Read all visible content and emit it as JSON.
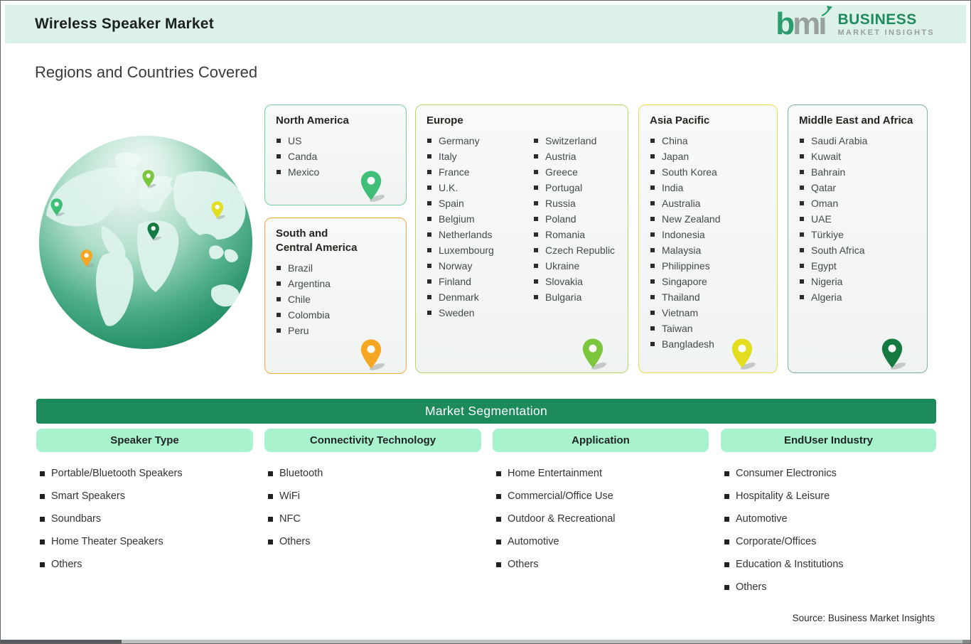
{
  "header": {
    "title": "Wireless Speaker Market",
    "logo": {
      "mark_b": "b",
      "mark_m": "m",
      "mark_i": "ı",
      "line1": "BUSINESS",
      "line2": "MARKET INSIGHTS"
    }
  },
  "section_title": "Regions and Countries Covered",
  "regions": [
    {
      "title_line1": "North America",
      "title_line2": "",
      "countries": [
        "US",
        "Canda",
        "Mexico"
      ]
    },
    {
      "title_line1": "South and",
      "title_line2": "Central America",
      "countries": [
        "Brazil",
        "Argentina",
        "Chile",
        "Colombia",
        "Peru"
      ]
    },
    {
      "title_line1": "Europe",
      "title_line2": "",
      "countries_col1": [
        "Germany",
        "Italy",
        "France",
        "U.K.",
        "Spain",
        "Belgium",
        "Netherlands",
        "Luxembourg",
        "Norway",
        "Finland",
        "Denmark",
        "Sweden"
      ],
      "countries_col2": [
        "Switzerland",
        "Austria",
        "Greece",
        "Portugal",
        "Russia",
        "Poland",
        "Romania",
        "Czech Republic",
        "Ukraine",
        "Slovakia",
        "Bulgaria"
      ]
    },
    {
      "title_line1": "Asia Pacific",
      "title_line2": "",
      "countries": [
        "China",
        "Japan",
        "South Korea",
        "India",
        "Australia",
        "New Zealand",
        "Indonesia",
        "Malaysia",
        "Philippines",
        "Singapore",
        "Thailand",
        "Vietnam",
        "Taiwan",
        "Bangladesh"
      ]
    },
    {
      "title_line1": "Middle East and Africa",
      "title_line2": "",
      "countries": [
        "Saudi Arabia",
        "Kuwait",
        "Bahrain",
        "Qatar",
        "Oman",
        "UAE",
        "Türkiye",
        "South Africa",
        "Egypt",
        "Nigeria",
        "Algeria"
      ]
    }
  ],
  "segmentation": {
    "banner": "Market Segmentation",
    "columns": [
      {
        "header": "Speaker Type",
        "items": [
          "Portable/Bluetooth Speakers",
          "Smart Speakers",
          "Soundbars",
          "Home Theater Speakers",
          "Others"
        ]
      },
      {
        "header": "Connectivity Technology",
        "items": [
          "Bluetooth",
          "WiFi",
          "NFC",
          "Others"
        ]
      },
      {
        "header": "Application",
        "items": [
          "Home Entertainment",
          "Commercial/Office Use",
          "Outdoor & Recreational",
          "Automotive",
          "Others"
        ]
      },
      {
        "header": "EndUser Industry",
        "items": [
          "Consumer Electronics",
          "Hospitality & Leisure",
          "Automotive",
          "Corporate/Offices",
          "Education & Institutions",
          "Others"
        ]
      }
    ]
  },
  "source": "Source: Business Market Insights",
  "colors": {
    "header_band": "#dcf1e7",
    "brand_green": "#1f8a5f",
    "logo_mark_green": "#2d9c6c",
    "logo_gray": "#98a09c",
    "banner_green": "#1c8a5a",
    "subheader_mint": "#a9f2ce",
    "na_accent": "#74cf9c",
    "na_pin": "#3fbe77",
    "sca_accent": "#f3aa3e",
    "sca_pin": "#f5a623",
    "eu_accent": "#b6d76c",
    "eu_pin": "#7cc63e",
    "ap_accent": "#e9e14c",
    "ap_pin": "#e2dd1f",
    "mea_accent": "#7fb3a0",
    "mea_pin": "#147a3f"
  }
}
